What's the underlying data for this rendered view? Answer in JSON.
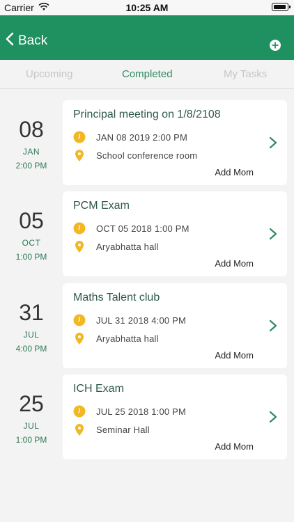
{
  "status_bar": {
    "carrier": "Carrier",
    "time": "10:25 AM"
  },
  "header": {
    "back_label": "Back",
    "icons": {
      "back": "chevron-left-icon",
      "add": "plus-circle-icon"
    },
    "background": "#1f9060"
  },
  "tabs": [
    {
      "label": "Upcoming",
      "active": false
    },
    {
      "label": "Completed",
      "active": true
    },
    {
      "label": "My Tasks",
      "active": false
    }
  ],
  "meetings": [
    {
      "day": "08",
      "month": "JAN",
      "time": "2:00 PM",
      "title": "Principal meeting on 1/8/2108",
      "datetime": "JAN 08 2019 2:00 PM",
      "location": "School conference room",
      "action": "Add Mom"
    },
    {
      "day": "05",
      "month": "OCT",
      "time": "1:00 PM",
      "title": "PCM Exam",
      "datetime": "OCT 05 2018 1:00 PM",
      "location": "Aryabhatta hall",
      "action": "Add Mom"
    },
    {
      "day": "31",
      "month": "JUL",
      "time": "4:00 PM",
      "title": "Maths Talent club",
      "datetime": "JUL 31 2018 4:00 PM",
      "location": "Aryabhatta hall",
      "action": "Add Mom"
    },
    {
      "day": "25",
      "month": "JUL",
      "time": "1:00 PM",
      "title": "ICH Exam",
      "datetime": "JUL 25 2018 1:00 PM",
      "location": "Seminar Hall",
      "action": "Add Mom"
    }
  ],
  "colors": {
    "accent": "#1f9060",
    "icon_yellow": "#f2b824",
    "chevron": "#2f8a60"
  }
}
